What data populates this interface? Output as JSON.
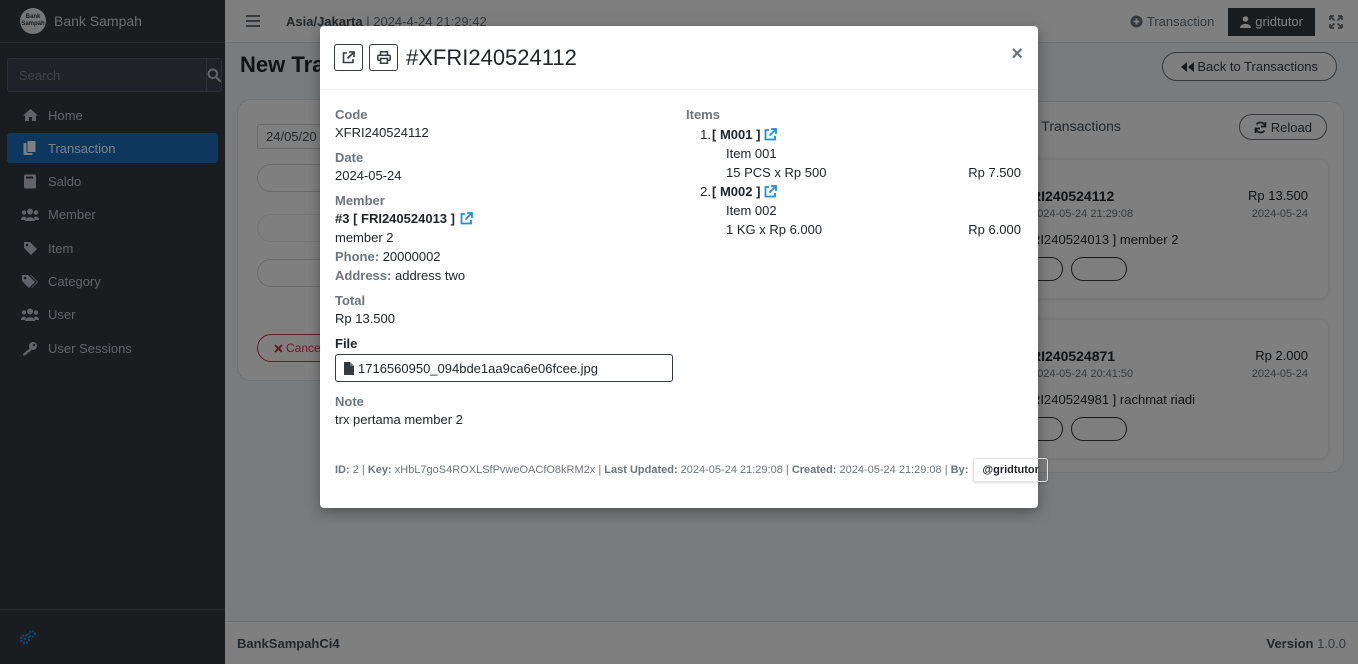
{
  "brand": {
    "name": "Bank Sampah",
    "logo_line1": "Bank",
    "logo_line2": "Sampah"
  },
  "sidebar": {
    "search_placeholder": "Search",
    "items": [
      {
        "label": "Home",
        "icon": "home-icon"
      },
      {
        "label": "Transaction",
        "icon": "copy-icon",
        "active": true
      },
      {
        "label": "Saldo",
        "icon": "book-icon"
      },
      {
        "label": "Member",
        "icon": "users-icon"
      },
      {
        "label": "Item",
        "icon": "tag-icon"
      },
      {
        "label": "Category",
        "icon": "tags-icon"
      },
      {
        "label": "User",
        "icon": "users-icon"
      },
      {
        "label": "User Sessions",
        "icon": "key-icon"
      }
    ]
  },
  "topbar": {
    "timezone": "Asia/Jakarta",
    "datetime": "2024-4-24 21:29:42",
    "transaction_label": "Transaction",
    "user_label": "gridtutor"
  },
  "main": {
    "page_title": "New Tra",
    "back_label": "Back to Transactions",
    "date_value": "24/05/20",
    "cancel_label": "Cance",
    "right_card_title": "r Transactions",
    "reload_label": "Reload",
    "transactions": [
      {
        "code": "RI240524112",
        "amount": "Rp 13.500",
        "time": "2024-05-24 21:29:08",
        "date": "2024-05-24",
        "member": "RI240524013 ] member 2"
      },
      {
        "code": "RI240524871",
        "amount": "Rp 2.000",
        "time": "2024-05-24 20:41:50",
        "date": "2024-05-24",
        "member": "RI240524981 ] rachmat riadi"
      }
    ]
  },
  "footer": {
    "left": "BankSampahCi4",
    "version_label": "Version",
    "version": "1.0.0"
  },
  "modal": {
    "title": "#XFRI240524112",
    "code_label": "Code",
    "code": "XFRI240524112",
    "date_label": "Date",
    "date": "2024-05-24",
    "member_label": "Member",
    "member_code": "#3 [ FRI240524013 ]",
    "member_name": "member 2",
    "phone_label": "Phone:",
    "phone": "20000002",
    "address_label": "Address:",
    "address": "address two",
    "total_label": "Total",
    "total": "Rp 13.500",
    "file_label": "File",
    "file_name": "1716560950_094bde1aa9ca6e06fcee.jpg",
    "note_label": "Note",
    "note": "trx pertama member 2",
    "items_label": "Items",
    "items": [
      {
        "num": "1.",
        "code": "[ M001 ]",
        "name": "Item 001",
        "qty": "15 PCS x Rp 500",
        "subtotal": "Rp 7.500"
      },
      {
        "num": "2.",
        "code": "[ M002 ]",
        "name": "Item 002",
        "qty": "1 KG x Rp 6.000",
        "subtotal": "Rp 6.000"
      }
    ],
    "meta": {
      "id_label": "ID:",
      "id": "2",
      "key_label": "Key:",
      "key": "xHbL7goS4ROXLSfPvweOACfO8kRM2x",
      "updated_label": "Last Updated:",
      "updated": "2024-05-24 21:29:08",
      "created_label": "Created:",
      "created": "2024-05-24 21:29:08",
      "by_label": "By:",
      "by": "@gridtutor"
    }
  },
  "colors": {
    "sidebar_bg": "#343a40",
    "active": "#1a6fbf",
    "link": "#1a8fe3",
    "danger": "#dc3545"
  }
}
